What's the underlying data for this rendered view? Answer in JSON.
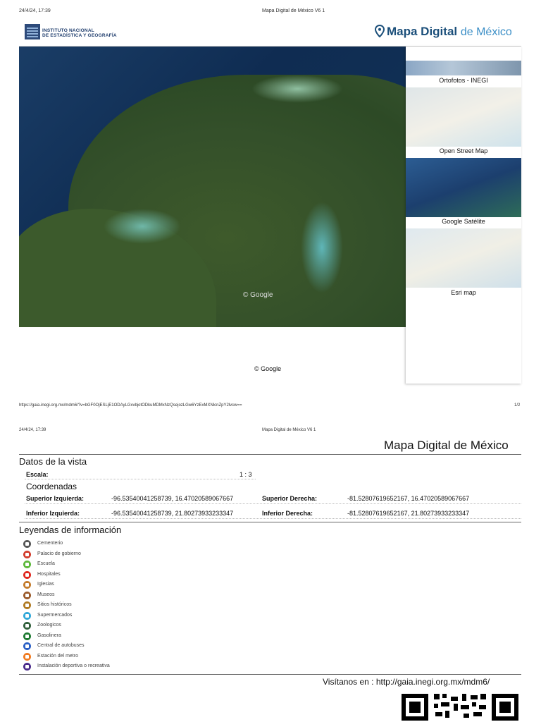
{
  "page1": {
    "timestamp": "24/4/24, 17:39",
    "doc_title": "Mapa Digital de México V6 1",
    "inegi_line1": "INSTITUTO NACIONAL",
    "inegi_line2": "DE ESTADÍSTICA Y GEOGRAFÍA",
    "brand_bold": "Mapa Digital",
    "brand_light": "de México",
    "map_attribution": "© Google",
    "layers": [
      "Ortofotos - INEGI",
      "Open Street Map",
      "Google Satélite",
      "Esri map"
    ],
    "bottom_attribution": "© Google",
    "url": "https://gaia.inegi.org.mx/mdm6/?v=bGF0OjESLjE1ODAyLGxvbjotODkuMDMxNzQsejozLGw6YzExMXNlcnZpY2lvcw==",
    "page_num": "1/2"
  },
  "page2": {
    "timestamp": "24/4/24, 17:39",
    "doc_title": "Mapa Digital de México V6 1",
    "title": "Mapa Digital de México",
    "datos_heading": "Datos de la vista",
    "escala_label": "Escala:",
    "escala_value": "1 : 3",
    "coords_heading": "Coordenadas",
    "sup_izq_label": "Superior Izquierda:",
    "sup_izq_value": "-96.53540041258739, 16.47020589067667",
    "sup_der_label": "Superior Derecha:",
    "sup_der_value": "-81.52807619652167, 16.47020589067667",
    "inf_izq_label": "Inferior Izquierda:",
    "inf_izq_value": "-96.53540041258739, 21.80273933233347",
    "inf_der_label": "Inferior Derecha:",
    "inf_der_value": "-81.52807619652167, 21.80273933233347",
    "legend_heading": "Leyendas de información",
    "legend": [
      {
        "label": "Cementerio",
        "color": "#555555",
        "icon": "cemetery-icon"
      },
      {
        "label": "Palacio de gobierno",
        "color": "#d23c2c",
        "icon": "government-palace-icon"
      },
      {
        "label": "Escuela",
        "color": "#5cb83a",
        "icon": "school-icon"
      },
      {
        "label": "Hospitales",
        "color": "#e0261d",
        "icon": "hospital-icon"
      },
      {
        "label": "Iglesias",
        "color": "#c47a2a",
        "icon": "church-icon"
      },
      {
        "label": "Museos",
        "color": "#9a5a2a",
        "icon": "museum-icon"
      },
      {
        "label": "Sitios históricos",
        "color": "#b07a22",
        "icon": "historic-site-icon"
      },
      {
        "label": "Supermercados",
        "color": "#2fa7d8",
        "icon": "supermarket-icon"
      },
      {
        "label": "Zoologicos",
        "color": "#2f5f3a",
        "icon": "zoo-icon"
      },
      {
        "label": "Gasolinera",
        "color": "#1e7a32",
        "icon": "gas-station-icon"
      },
      {
        "label": "Central de autobuses",
        "color": "#2a5fc4",
        "icon": "bus-station-icon"
      },
      {
        "label": "Estación del metro",
        "color": "#f07a20",
        "icon": "metro-station-icon"
      },
      {
        "label": "Instalación deportiva o recreativa",
        "color": "#4a2a8a",
        "icon": "sports-facility-icon"
      }
    ],
    "visit": "Visítanos en : http://gaia.inegi.org.mx/mdm6/"
  }
}
